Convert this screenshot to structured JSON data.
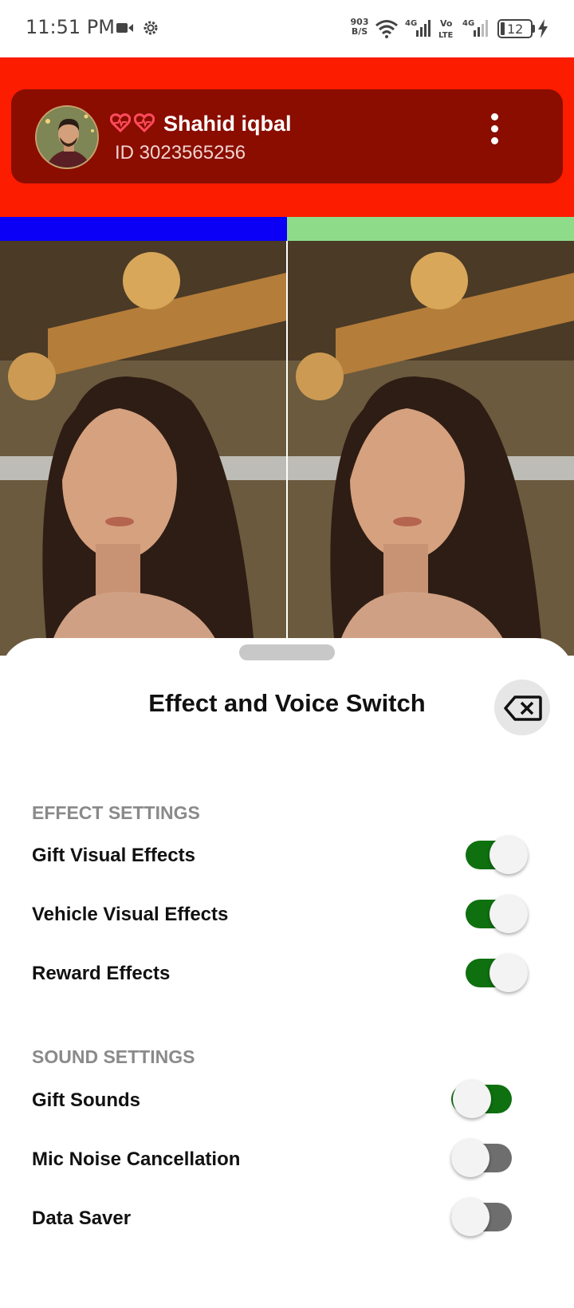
{
  "status_bar": {
    "time": "11:51 PM",
    "net_speed_value": "903",
    "net_speed_unit": "B/S",
    "battery_level": "12",
    "icons": [
      "video-icon",
      "gear-icon",
      "wifi-icon",
      "signal-4g-icon",
      "volte-icon",
      "signal-4g-icon",
      "battery-icon",
      "charging-icon"
    ]
  },
  "profile": {
    "name": "Shahid iqbal",
    "id_text": "ID 3023565256",
    "badges": [
      "heart-badge-icon",
      "heart-badge-icon"
    ],
    "menu_icon": "more-vertical-icon"
  },
  "seats": {
    "left_color": "#0b00f5",
    "right_color": "#8edc8a"
  },
  "sheet": {
    "title": "Effect and Voice Switch",
    "close_icon": "backspace-close-icon",
    "sections": [
      {
        "title": "EFFECT SETTINGS",
        "items": [
          {
            "label": "Gift Visual Effects",
            "on": true
          },
          {
            "label": "Vehicle Visual Effects",
            "on": true
          },
          {
            "label": "Reward Effects",
            "on": true
          }
        ]
      },
      {
        "title": "SOUND SETTINGS",
        "items": [
          {
            "label": "Gift Sounds",
            "on": true
          },
          {
            "label": "Mic Noise Cancellation",
            "on": false
          },
          {
            "label": "Data Saver",
            "on": false
          }
        ]
      }
    ]
  },
  "colors": {
    "header_red": "#fc1c00",
    "card_dark_red": "#8a0d00",
    "toggle_on": "#0f7010",
    "toggle_off": "#6e6e6e"
  }
}
